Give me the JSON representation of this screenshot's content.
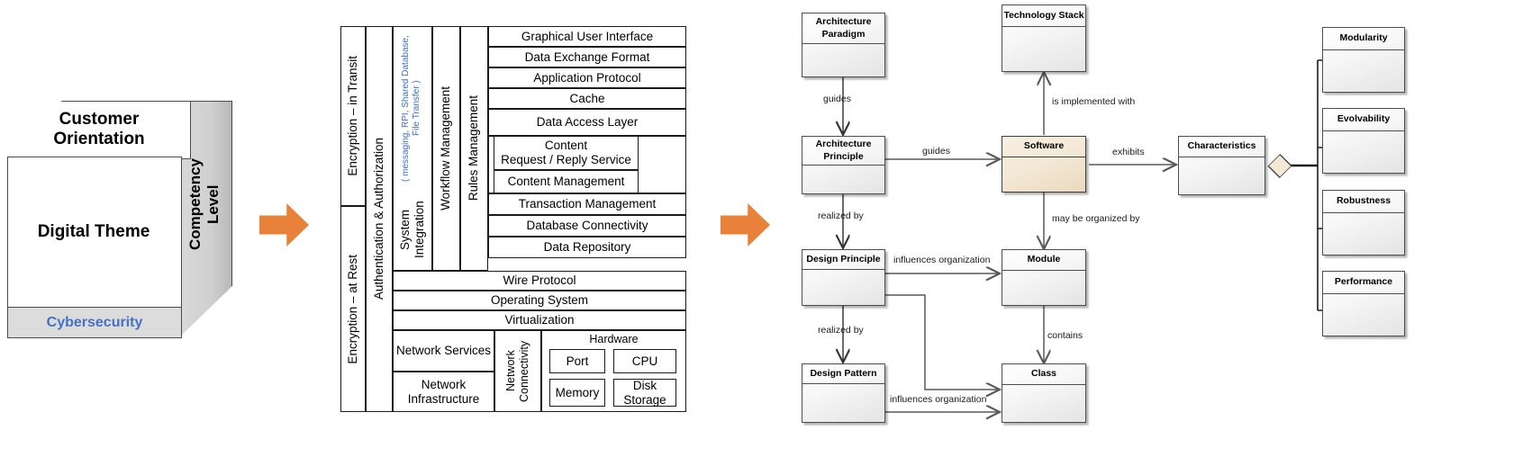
{
  "cube": {
    "top_label": "Customer\nOrientation",
    "top_line1": "Customer",
    "top_line2": "Orientation",
    "side_label": "Competency\nLevel",
    "side_line1": "Competency",
    "side_line2": "Level",
    "front_label": "Digital Theme",
    "bottom_label": "Cybersecurity",
    "accent_color": "#4472c4",
    "side_fill": "#d0d0d0",
    "bottom_fill": "#dcdcdc"
  },
  "arrows": {
    "color": "#e8813a",
    "arrow_1_name": "orange-arrow",
    "arrow_2_name": "orange-arrow"
  },
  "layer_table": {
    "cross_cutting": [
      "Encryption – in Transit",
      "Encryption – at Rest",
      "Authentication &  Authorization"
    ],
    "encryption_in_transit": "Encryption – in Transit",
    "encryption_at_rest": "Encryption – at Rest",
    "auth": "Authentication &  Authorization",
    "system_integration": "System  Integration",
    "system_integration_sub": "( messaging,  RPI,  Shared Database,  File Transfer )",
    "workflow_management": "Workflow Management",
    "rules_management": "Rules Management",
    "layers": [
      "Graphical User Interface",
      "Data Exchange Format",
      "Application Protocol",
      "Cache",
      "Data Access Layer",
      "Transaction Management",
      "Database Connectivity",
      "Data Repository"
    ],
    "gui": "Graphical User Interface",
    "data_exchange_format": "Data Exchange Format",
    "application_protocol": "Application Protocol",
    "cache": "Cache",
    "data_access_layer": "Data Access Layer",
    "content_request_reply_line1": "Content",
    "content_request_reply_line2": "Request / Reply Service",
    "content_management": "Content Management",
    "transaction_management": "Transaction Management",
    "database_connectivity": "Database Connectivity",
    "data_repository": "Data Repository",
    "wire_protocol": "Wire Protocol",
    "operating_system": "Operating System",
    "virtualization": "Virtualization",
    "network_services": "Network Services",
    "network_infrastructure_line1": "Network",
    "network_infrastructure_line2": "Infrastructure",
    "network_connectivity": "Network Connectivity",
    "hardware": "Hardware",
    "hardware_items": [
      "Port",
      "CPU",
      "Memory",
      "Disk Storage"
    ],
    "hw_port": "Port",
    "hw_cpu": "CPU",
    "hw_memory": "Memory",
    "hw_disk_line1": "Disk",
    "hw_disk_line2": "Storage",
    "sub_note_color": "#3b6fc4"
  },
  "uml": {
    "classes": {
      "architecture_paradigm": "Architecture\nParadigm",
      "architecture_paradigm_l1": "Architecture",
      "architecture_paradigm_l2": "Paradigm",
      "architecture_principle_l1": "Architecture",
      "architecture_principle_l2": "Principle",
      "design_principle": "Design Principle",
      "design_pattern": "Design Pattern",
      "technology_stack": "Technology  Stack",
      "software": "Software",
      "module": "Module",
      "class": "Class",
      "characteristics": "Characteristics",
      "modularity": "Modularity",
      "evolvability": "Evolvability",
      "robustness": "Robustness",
      "performance": "Performance"
    },
    "relations": {
      "guides_vertical": "guides",
      "guides_horizontal": "guides",
      "is_implemented_with": "is implemented with",
      "exhibits": "exhibits",
      "may_be_organized_by": "may be organized by",
      "realized_by_1": "realized by",
      "realized_by_2": "realized by",
      "influences_organization_1": "influences organization",
      "influences_organization_2": "influences organization",
      "contains": "contains"
    },
    "highlight_fill": "#f3e8d5",
    "line_color": "#595959"
  }
}
